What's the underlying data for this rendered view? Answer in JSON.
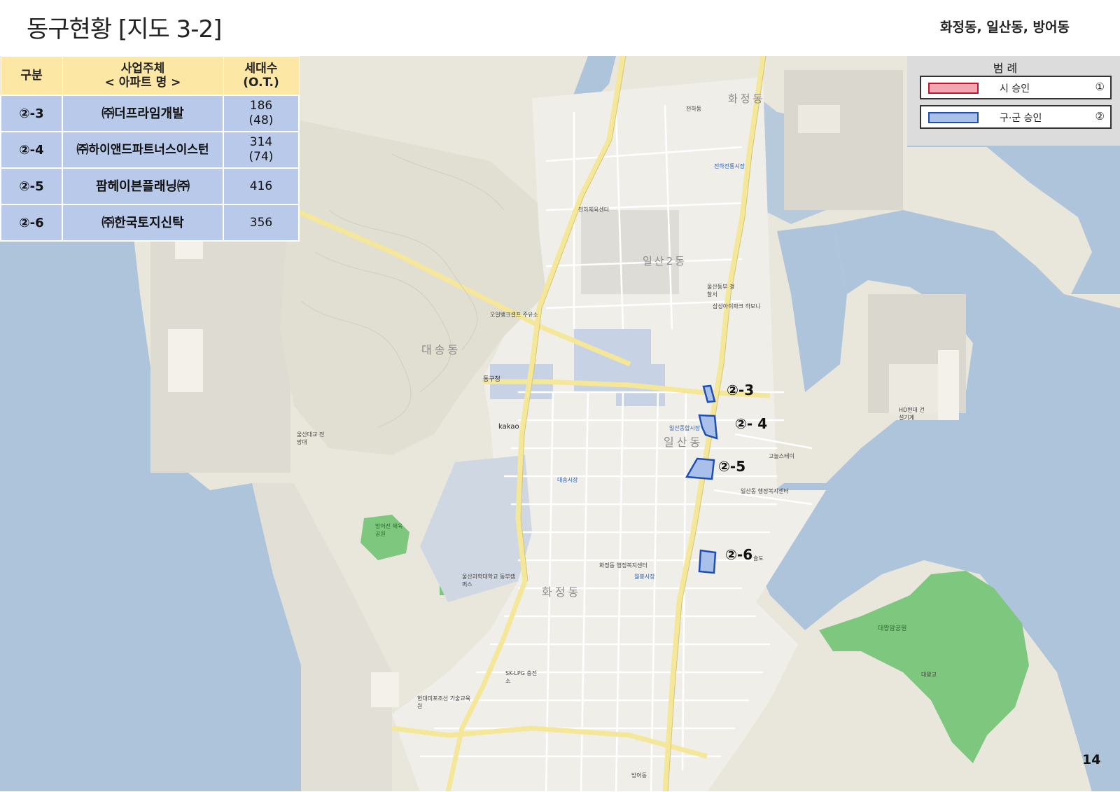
{
  "header": {
    "title": "동구현황 [지도 3-2]",
    "subtitle": "화정동,  일산동,  방어동"
  },
  "table": {
    "headers": {
      "col1": "구분",
      "col2_line1": "사업주체",
      "col2_line2": "< 아파트 명 >",
      "col3_line1": "세대수",
      "col3_line2": "(O.T.)"
    },
    "rows": [
      {
        "id": "②-3",
        "name": "㈜더프라임개발",
        "units": "186",
        "ot": "(48)"
      },
      {
        "id": "②-4",
        "name": "㈜하이앤드파트너스이스턴",
        "units": "314",
        "ot": "(74)"
      },
      {
        "id": "②-5",
        "name": "팜헤이븐플래닝㈜",
        "units": "416",
        "ot": ""
      },
      {
        "id": "②-6",
        "name": "㈜한국토지신탁",
        "units": "356",
        "ot": ""
      }
    ]
  },
  "legend": {
    "title": "범 례",
    "items": [
      {
        "label": "시 승인",
        "mark": "①",
        "fill": "#f4a6b0",
        "stroke": "#c0182a"
      },
      {
        "label": "구·군 승인",
        "mark": "②",
        "fill": "#a9c1ea",
        "stroke": "#1f4fb0"
      }
    ]
  },
  "map": {
    "site_labels": [
      "②-3",
      "②- 4",
      "②-5",
      "②-6"
    ],
    "district_labels": [
      "대송동",
      "일산동",
      "화정동",
      "화정동",
      "일산2동"
    ],
    "place_labels": [
      "동구청",
      "전하체육센터",
      "오일뱅크셀프 주유소",
      "울산대교 전망대",
      "방어진 체육공원",
      "울산과학대학교 동부캠퍼스",
      "화정동 행정복지센터",
      "일산동 행정복지센터",
      "대왕암공원",
      "울산동부 경찰서",
      "HD현대 건설기계",
      "현대미포조선 기술교육원",
      "SK-LPG 충전소",
      "kakao",
      "전하동",
      "방어동",
      "대송시장",
      "월봉시장",
      "일산종합시장",
      "전하전통시장",
      "삼성아이파크 하모니",
      "슬도",
      "대왕교",
      "고늘스테이"
    ]
  },
  "page_number": "14",
  "colors": {
    "sea": "#aec4db",
    "land": "#e9e6dc",
    "green": "#7ec77f",
    "road_main": "#f5e79a",
    "header_fill": "#fde7a5",
    "row_fill": "#b8c9e9",
    "site_fill": "#a9c1ea",
    "site_stroke": "#1f4fb0"
  }
}
